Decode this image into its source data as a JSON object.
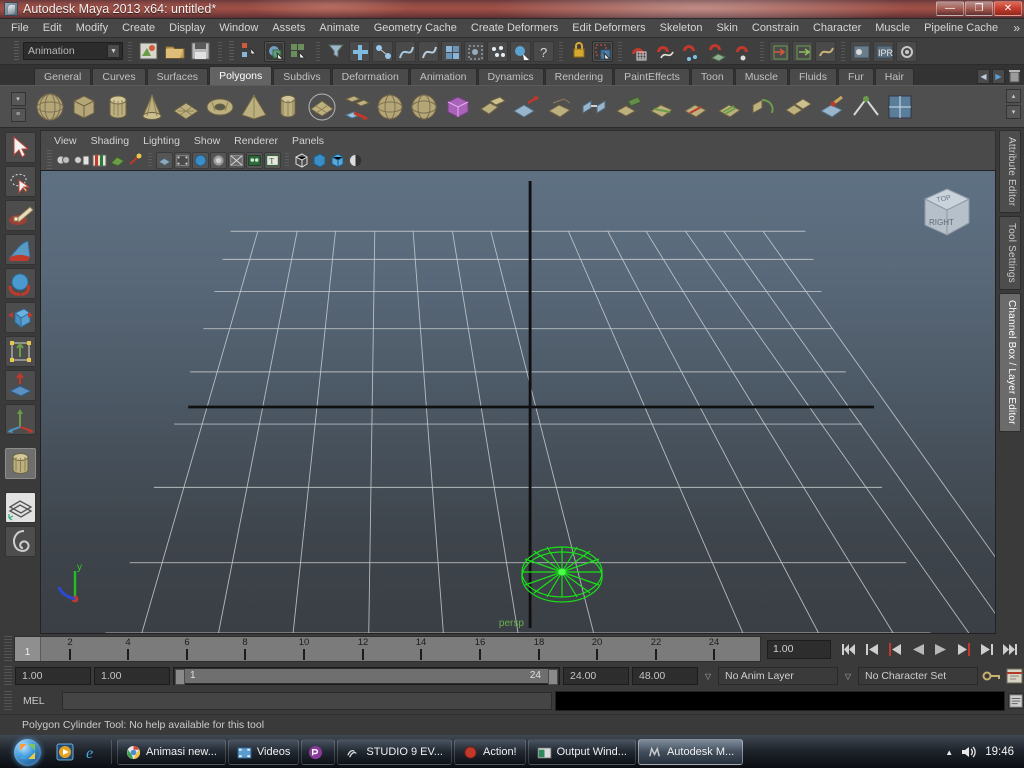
{
  "titlebar": {
    "title": "Autodesk Maya 2013 x64: untitled*",
    "icon": "maya-app-icon",
    "minimize": "—",
    "maximize": "❐",
    "close": "✕"
  },
  "menubar": {
    "items": [
      {
        "label": "File"
      },
      {
        "label": "Edit"
      },
      {
        "label": "Modify"
      },
      {
        "label": "Create"
      },
      {
        "label": "Display"
      },
      {
        "label": "Window"
      },
      {
        "label": "Assets"
      },
      {
        "label": "Animate"
      },
      {
        "label": "Geometry Cache"
      },
      {
        "label": "Create Deformers"
      },
      {
        "label": "Edit Deformers"
      },
      {
        "label": "Skeleton"
      },
      {
        "label": "Skin"
      },
      {
        "label": "Constrain"
      },
      {
        "label": "Character"
      },
      {
        "label": "Muscle"
      },
      {
        "label": "Pipeline Cache"
      }
    ],
    "overflow": "»"
  },
  "statusline": {
    "menuset": "Animation",
    "menuset_arrow": "▼",
    "icons": [
      "new-scene-icon",
      "open-scene-icon",
      "save-scene-icon",
      "select-by-hierarchy-icon",
      "select-by-object-icon",
      "select-by-component-icon",
      "filter-select-icon",
      "select-all-icon",
      "select-hierarchy-icon",
      "select-curve-icon",
      "snap-grid-icon",
      "snap-curve-icon",
      "snap-point-icon",
      "snap-plane-icon",
      "snap-view-icon",
      "lock-selection-icon",
      "highlight-selection-icon",
      "input-connections-icon",
      "output-connections-icon",
      "construction-history-icon",
      "render-current-frame-icon",
      "ipr-render-icon",
      "render-settings-icon",
      "help-icon"
    ]
  },
  "shelf": {
    "tabs": [
      {
        "label": "General",
        "active": false
      },
      {
        "label": "Curves",
        "active": false
      },
      {
        "label": "Surfaces",
        "active": false
      },
      {
        "label": "Polygons",
        "active": true
      },
      {
        "label": "Subdivs",
        "active": false
      },
      {
        "label": "Deformation",
        "active": false
      },
      {
        "label": "Animation",
        "active": false
      },
      {
        "label": "Dynamics",
        "active": false
      },
      {
        "label": "Rendering",
        "active": false
      },
      {
        "label": "PaintEffects",
        "active": false
      },
      {
        "label": "Toon",
        "active": false
      },
      {
        "label": "Muscle",
        "active": false
      },
      {
        "label": "Fluids",
        "active": false
      },
      {
        "label": "Fur",
        "active": false
      },
      {
        "label": "Hair",
        "active": false
      }
    ],
    "nav_left": "◀",
    "nav_right": "▶",
    "trash": "trash-icon",
    "items": [
      "polygon-sphere-icon",
      "polygon-cube-icon",
      "polygon-cylinder-icon",
      "polygon-cone-icon",
      "polygon-plane-icon",
      "polygon-torus-icon",
      "polygon-pyramid-icon",
      "polygon-prism-icon",
      "polygon-disc-icon",
      "combine-icon",
      "sculpt-geometry-icon",
      "smooth-icon",
      "subdiv-proxy-icon",
      "boolean-union-icon",
      "extrude-icon",
      "bevel-icon",
      "bridge-icon",
      "append-polygon-icon",
      "split-polygon-icon",
      "insert-edge-loop-icon",
      "offset-edge-loop-icon",
      "wedge-face-icon",
      "duplicate-face-icon",
      "paint-reduce-icon",
      "crease-tool-icon",
      "uv-texture-icon"
    ]
  },
  "toolbox": {
    "items": [
      {
        "name": "select-tool",
        "selected": false
      },
      {
        "name": "lasso-select-tool",
        "selected": false
      },
      {
        "name": "paint-select-tool",
        "selected": false
      },
      {
        "name": "move-tool",
        "selected": false
      },
      {
        "name": "rotate-tool",
        "selected": false
      },
      {
        "name": "scale-tool",
        "selected": false
      },
      {
        "name": "universal-manipulator-tool",
        "selected": false
      },
      {
        "name": "soft-modification-tool",
        "selected": false
      },
      {
        "name": "show-manipulator-tool",
        "selected": false
      },
      {
        "name": "last-tool-used",
        "selected": true
      },
      {
        "name": "single-perspective-layout",
        "selected": false
      },
      {
        "name": "four-view-layout",
        "selected": false
      }
    ]
  },
  "viewport": {
    "menus": [
      "View",
      "Shading",
      "Lighting",
      "Show",
      "Renderer",
      "Panels"
    ],
    "toolbar_icons": [
      "select-camera-icon",
      "camera-attributes-icon",
      "bookmark-icon",
      "image-plane-icon",
      "twopointthree-icon",
      "grid-toggle-icon",
      "film-gate-icon",
      "resolution-gate-icon",
      "gate-mask-icon",
      "xray-icon",
      "texture-icon",
      "wireframe-on-shaded-icon",
      "smooth-shade-icon",
      "flat-shade-icon",
      "use-default-material-icon",
      "shadows-icon",
      "lighting-icon",
      "isolate-select-icon",
      "hardware-texturing-icon"
    ],
    "camera_label": "persp",
    "viewcube": {
      "top_face": "TOP",
      "right_face": "RIGHT"
    },
    "axis_labels": {
      "y": "y",
      "x": "x",
      "z": "z"
    },
    "selected_object": "pCylinder1",
    "selection_color": "#00ee00",
    "grid_color": "#c9cdd1",
    "bg_top": "#5d6f80",
    "bg_bottom": "#3b4046"
  },
  "right_panel_tabs": [
    {
      "label": "Attribute Editor",
      "active": false
    },
    {
      "label": "Tool Settings",
      "active": false
    },
    {
      "label": "Channel Box / Layer Editor",
      "active": true
    }
  ],
  "time_slider": {
    "current_frame": "1",
    "ticks": [
      2,
      4,
      6,
      8,
      10,
      12,
      14,
      16,
      18,
      20,
      22,
      24
    ],
    "frame_field": "1.00",
    "playback_buttons": [
      "go-to-start-icon",
      "step-back-keyframe-icon",
      "step-back-frame-icon",
      "play-backwards-icon",
      "play-forwards-icon",
      "step-forward-frame-icon",
      "step-forward-keyframe-icon",
      "go-to-end-icon"
    ]
  },
  "range_slider": {
    "anim_start": "1.00",
    "range_start": "1.00",
    "range_bar_min": "1",
    "range_bar_max": "24",
    "range_end": "24.00",
    "anim_end": "48.00",
    "anim_layer": "No Anim Layer",
    "character_set": "No Character Set",
    "dropdown_arrow": "▽",
    "key_icon": "auto-keyframe-icon",
    "prefs_icon": "animation-preferences-icon"
  },
  "command_line": {
    "label": "MEL",
    "input_value": "",
    "output_value": "",
    "script_editor_icon": "script-editor-icon"
  },
  "help_line": {
    "text": "Polygon Cylinder Tool: No help available for this tool"
  },
  "taskbar": {
    "start": "windows-start-orb",
    "quick_launch": [
      "media-player-icon",
      "internet-explorer-icon"
    ],
    "buttons": [
      {
        "label": "Animasi new...",
        "icon": "chrome-icon",
        "active": false
      },
      {
        "label": "Videos",
        "icon": "folder-videos-icon",
        "active": false
      },
      {
        "label": "",
        "icon": "photoshop-icon",
        "active": false
      },
      {
        "label": "STUDIO 9 EV...",
        "icon": "studio-icon",
        "active": false
      },
      {
        "label": "Action!",
        "icon": "action-record-icon",
        "active": false
      },
      {
        "label": "Output Wind...",
        "icon": "output-window-icon",
        "active": false
      },
      {
        "label": "Autodesk M...",
        "icon": "maya-icon",
        "active": true
      }
    ],
    "tray_expand": "▲",
    "volume_icon": "volume-icon",
    "clock": "19:46"
  }
}
